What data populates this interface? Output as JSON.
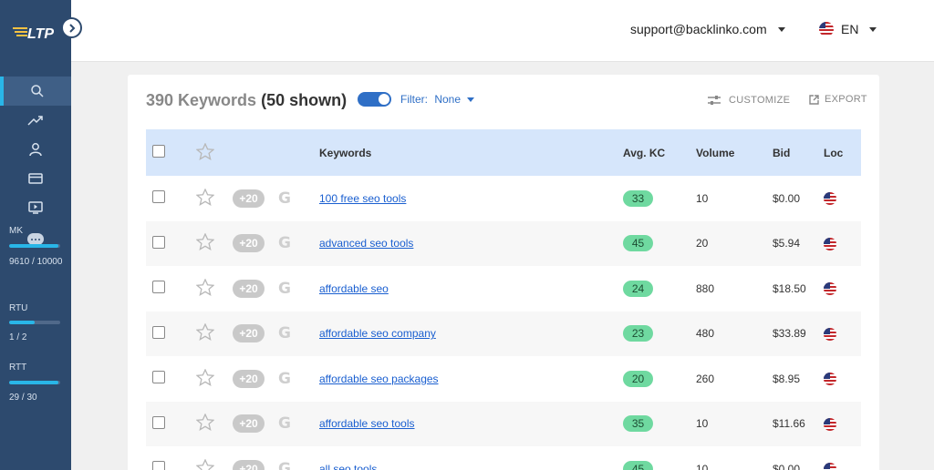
{
  "sidebar": {
    "logo_text": "LTP",
    "stats": [
      {
        "label": "MK",
        "value": "9610 / 10000",
        "fraction": 0.961
      },
      {
        "label": "RTU",
        "value": "1 / 2",
        "fraction": 0.5
      },
      {
        "label": "RTT",
        "value": "29 / 30",
        "fraction": 0.967
      }
    ]
  },
  "header": {
    "account_email": "support@backlinko.com",
    "language": "EN"
  },
  "toolbar": {
    "count_text": "390 Keywords",
    "shown_text": "(50 shown)",
    "filter_label": "Filter:",
    "filter_value": "None",
    "customize_label": "CUSTOMIZE",
    "export_label": "EXPORT"
  },
  "table": {
    "columns": {
      "keywords": "Keywords",
      "avg_kc": "Avg. KC",
      "volume": "Volume",
      "bid": "Bid",
      "loc": "Loc"
    },
    "plus_label": "+20",
    "rows": [
      {
        "keyword": "100 free seo tools",
        "kc": "33",
        "volume": "10",
        "bid": "$0.00"
      },
      {
        "keyword": "advanced seo tools",
        "kc": "45",
        "volume": "20",
        "bid": "$5.94"
      },
      {
        "keyword": "affordable seo",
        "kc": "24",
        "volume": "880",
        "bid": "$18.50"
      },
      {
        "keyword": "affordable seo company",
        "kc": "23",
        "volume": "480",
        "bid": "$33.89"
      },
      {
        "keyword": "affordable seo packages",
        "kc": "20",
        "volume": "260",
        "bid": "$8.95"
      },
      {
        "keyword": "affordable seo tools",
        "kc": "35",
        "volume": "10",
        "bid": "$11.66"
      },
      {
        "keyword": "all seo tools",
        "kc": "45",
        "volume": "10",
        "bid": "$0.00"
      }
    ]
  },
  "colors": {
    "sidebar": "#2d4a6e",
    "accent": "#29b6e8",
    "link": "#1a5fd0",
    "kc_pill": "#6fd9a0",
    "header_row": "#d6e6fb"
  }
}
